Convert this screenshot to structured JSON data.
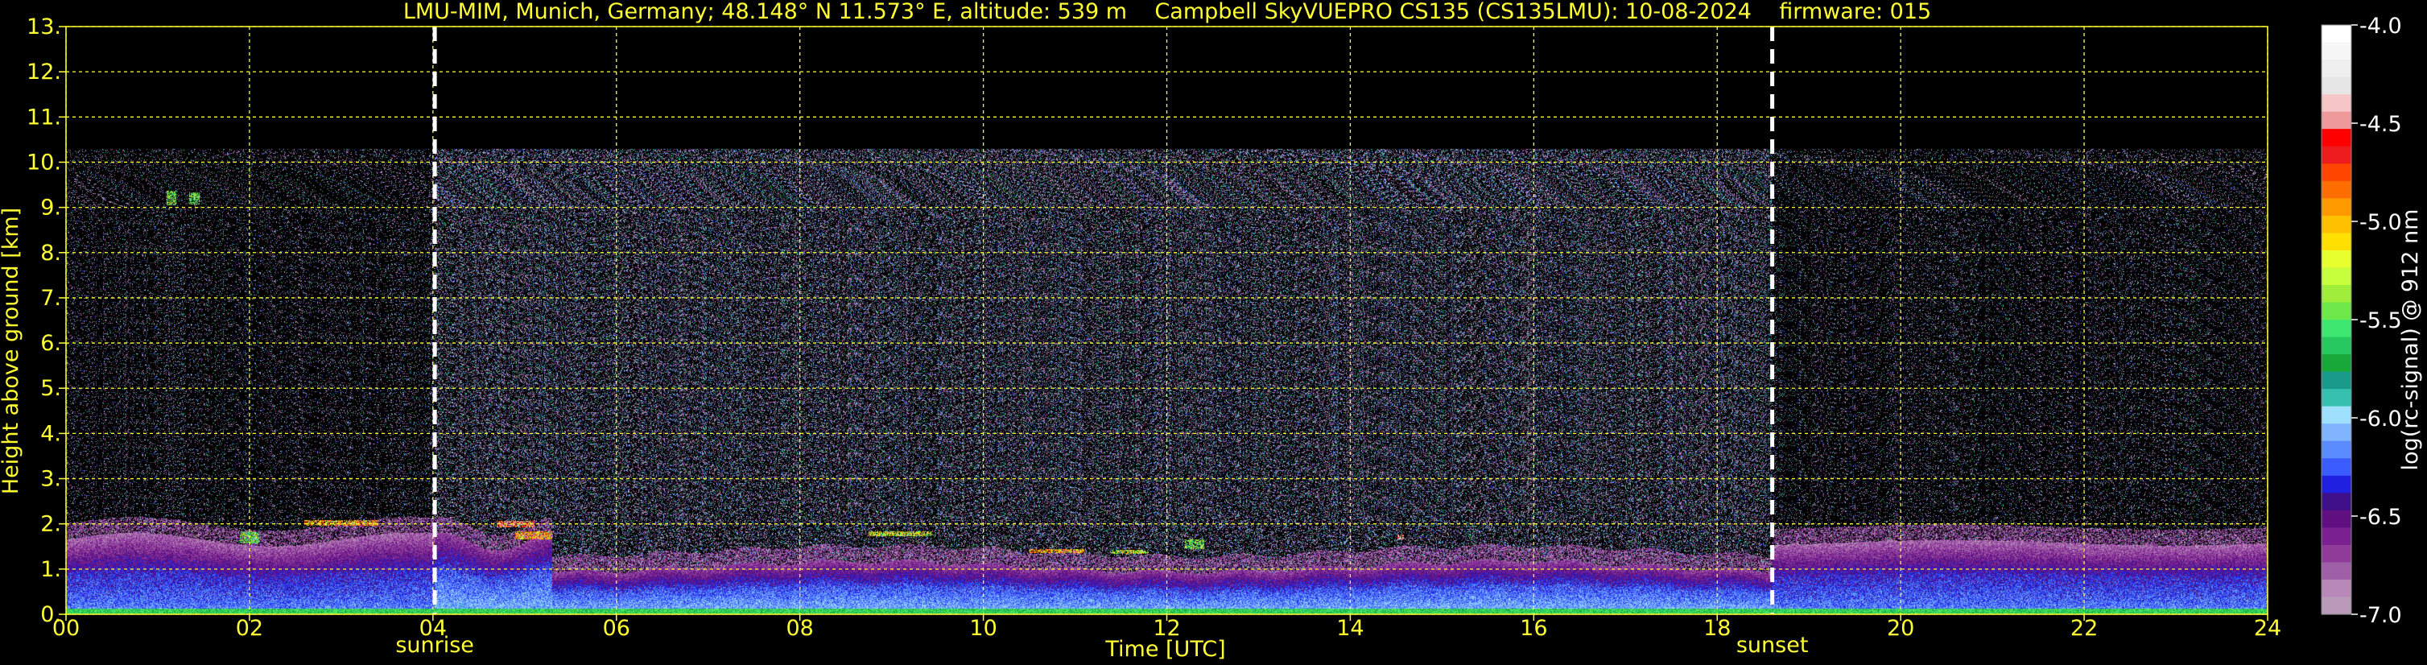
{
  "chart_data": {
    "type": "heatmap",
    "title": "LMU-MIM, Munich, Germany; 48.148° N 11.573° E, altitude: 539 m    Campbell SkyVUEPRO CS135 (CS135LMU): 10-08-2024    firmware: 015",
    "xlabel": "Time [UTC]",
    "ylabel": "Height above ground [km]",
    "xlim": [
      0,
      24
    ],
    "ylim": [
      0,
      13
    ],
    "x_ticks": [
      "00",
      "02",
      "04",
      "06",
      "08",
      "10",
      "12",
      "14",
      "16",
      "18",
      "20",
      "22",
      "24"
    ],
    "y_ticks": [
      "0.",
      "1.",
      "2.",
      "3.",
      "4.",
      "5.",
      "6.",
      "7.",
      "8.",
      "9.",
      "10.",
      "11.",
      "12.",
      "13."
    ],
    "grid": true,
    "events": [
      {
        "name": "sunrise",
        "time": 4.02
      },
      {
        "name": "sunset",
        "time": 18.6
      }
    ],
    "colorbar": {
      "label": "log(rc-signal) @ 912 nm",
      "range": [
        -7.0,
        -4.0
      ],
      "ticks": [
        "-4.0",
        "-4.5",
        "-5.0",
        "-5.5",
        "-6.0",
        "-6.5",
        "-7.0"
      ],
      "colors": [
        "#ffffff",
        "#f7f7f7",
        "#efefef",
        "#e6e6e6",
        "#f6c6c6",
        "#ee9a9a",
        "#ff0000",
        "#ee1c1c",
        "#ff4500",
        "#ff6e00",
        "#ff9900",
        "#ffc000",
        "#ffe000",
        "#e8ff30",
        "#c8ff3c",
        "#a0ee3a",
        "#6ee84a",
        "#3ee870",
        "#28c860",
        "#18a83a",
        "#1a9a8a",
        "#35c0b0",
        "#a0e0ff",
        "#80b4ff",
        "#5a8cff",
        "#3a5cff",
        "#2020e0",
        "#40108a",
        "#601080",
        "#7a2090",
        "#903a9a",
        "#a060a8",
        "#b888b8",
        "#b89ab8"
      ]
    },
    "data_summary": [
      {
        "feature": "boundary layer aerosol (strong signal)",
        "time": [
          0,
          24
        ],
        "height_km": [
          0.0,
          1.6
        ]
      },
      {
        "feature": "residual layer / layer top",
        "time": [
          0,
          5.3
        ],
        "height_km": [
          1.3,
          2.3
        ]
      },
      {
        "feature": "boundary layer top (evening)",
        "time": [
          18.6,
          24
        ],
        "height_km": [
          1.3,
          1.7
        ]
      },
      {
        "feature": "noise region (weak signal)",
        "time": [
          0,
          24
        ],
        "height_km": [
          2.0,
          10.3
        ]
      },
      {
        "feature": "no data above",
        "time": [
          0,
          24
        ],
        "height_km": [
          10.3,
          13.0
        ]
      }
    ]
  }
}
